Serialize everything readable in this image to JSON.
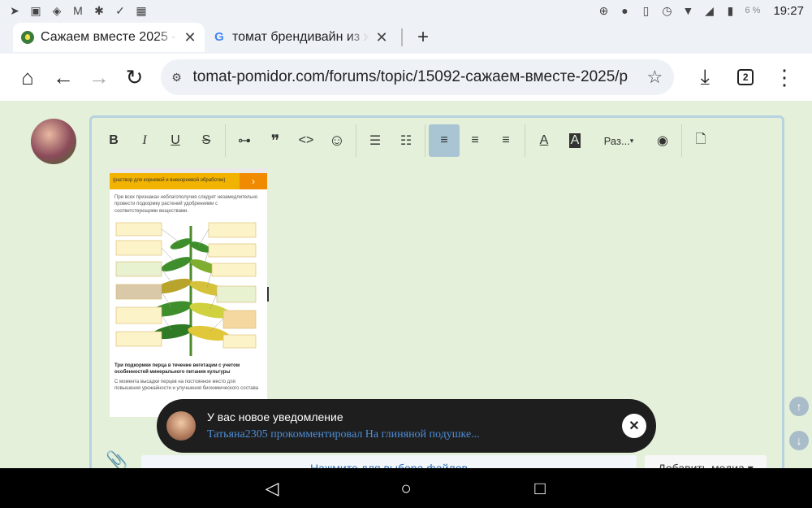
{
  "status_bar": {
    "time": "19:27",
    "battery": "6 %",
    "left_icons": [
      "telegram-icon",
      "gallery-icon",
      "shield-icon",
      "gmail-icon",
      "odnoklassniki-icon",
      "check-icon",
      "grid-icon"
    ],
    "right_icons": [
      "data-saver-icon",
      "location-icon",
      "vibrate-icon",
      "alarm-icon",
      "wifi-icon",
      "signal-icon",
      "battery-icon"
    ]
  },
  "tabs": [
    {
      "title": "Сажаем вместе 2025 - ",
      "close": "✕"
    },
    {
      "title": "томат брендивайн из х",
      "close": "✕"
    }
  ],
  "new_tab_label": "+",
  "address_bar": {
    "url": "tomat-pomidor.com/forums/topic/15092-сажаем-вместе-2025/p",
    "tab_count": "2"
  },
  "toolbar": {
    "buttons": [
      "B",
      "I",
      "U",
      "S",
      "link",
      "quote",
      "code",
      "emoji",
      "bullet-list",
      "numbered-list",
      "align-left",
      "align-center",
      "align-right",
      "text-color",
      "background-color",
      "size",
      "preview",
      "source"
    ],
    "size_label": "Раз...",
    "glyphs": {
      "bold": "B",
      "italic": "I",
      "underline": "U",
      "strike": "S",
      "quote": "❞",
      "code": "<>",
      "emoji": "☺",
      "eye": "👁"
    }
  },
  "picture": {
    "header_text": "(раствор для корневой и внекорневой обработки)",
    "intro": "При всех признаках неблагополучия следует незамедлительно провести подкормку растений удобрениями с соответствующими веществами.",
    "subtitle": "Три подкормки перца в течение вегетации с учетом особенностей минерального питания культуры",
    "footer": "С момента высадки перцев на постоянное место для повышения урожайности и улучшения биохимического состава"
  },
  "attachments": {
    "choose_files": "Нажмите для выбора файлов",
    "add_media": "Добавить медиа"
  },
  "notification": {
    "title": "У вас новое уведомление",
    "text": "Татьяна2305 прокомментировал На глиняной подушке...",
    "close": "✕"
  },
  "scroll": {
    "up": "↑",
    "down": "↓"
  },
  "android_nav": {
    "back": "◁",
    "home": "○",
    "recents": "□"
  }
}
